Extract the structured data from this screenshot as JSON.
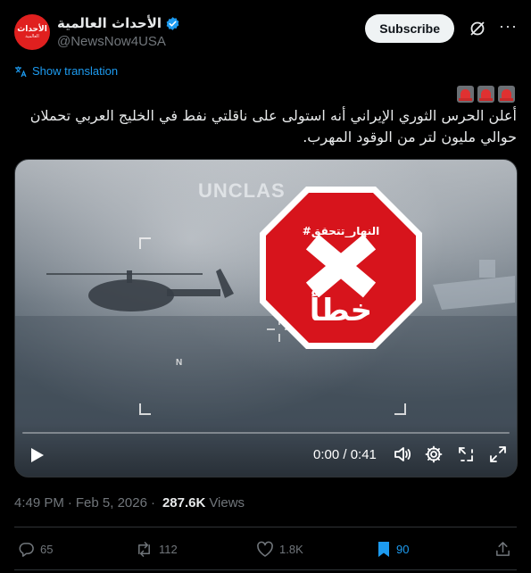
{
  "account": {
    "display_name": "الأحداث العالمية",
    "handle": "@NewsNow4USA",
    "avatar_logo_text": "الأحداث",
    "avatar_logo_sub": "العالمية",
    "verified": true
  },
  "header": {
    "subscribe_label": "Subscribe"
  },
  "post": {
    "show_translation": "Show translation",
    "emoji": "🚨🚨🚨",
    "text": "أعلن الحرس الثوري الإيراني أنه استولى على ناقلتي نفط في الخليج العربي تحملان حوالي مليون لتر من الوقود المهرب."
  },
  "video": {
    "overlay_watermark": "UNCLAS",
    "compass_marker": "N",
    "stamp_tag": "#النهار_تتحقق",
    "stamp_word": "خطأ",
    "time_display": "0:00 / 0:41",
    "progress": 0
  },
  "meta": {
    "time": "4:49 PM",
    "date": "Feb 5, 2026",
    "views_count": "287.6K",
    "views_label": "Views"
  },
  "actions": {
    "replies": "65",
    "reposts": "112",
    "likes": "1.8K",
    "bookmarks": "90"
  },
  "colors": {
    "accent": "#1d9bf0",
    "stamp_red": "#d7141c",
    "avatar_red": "#e0201f"
  }
}
